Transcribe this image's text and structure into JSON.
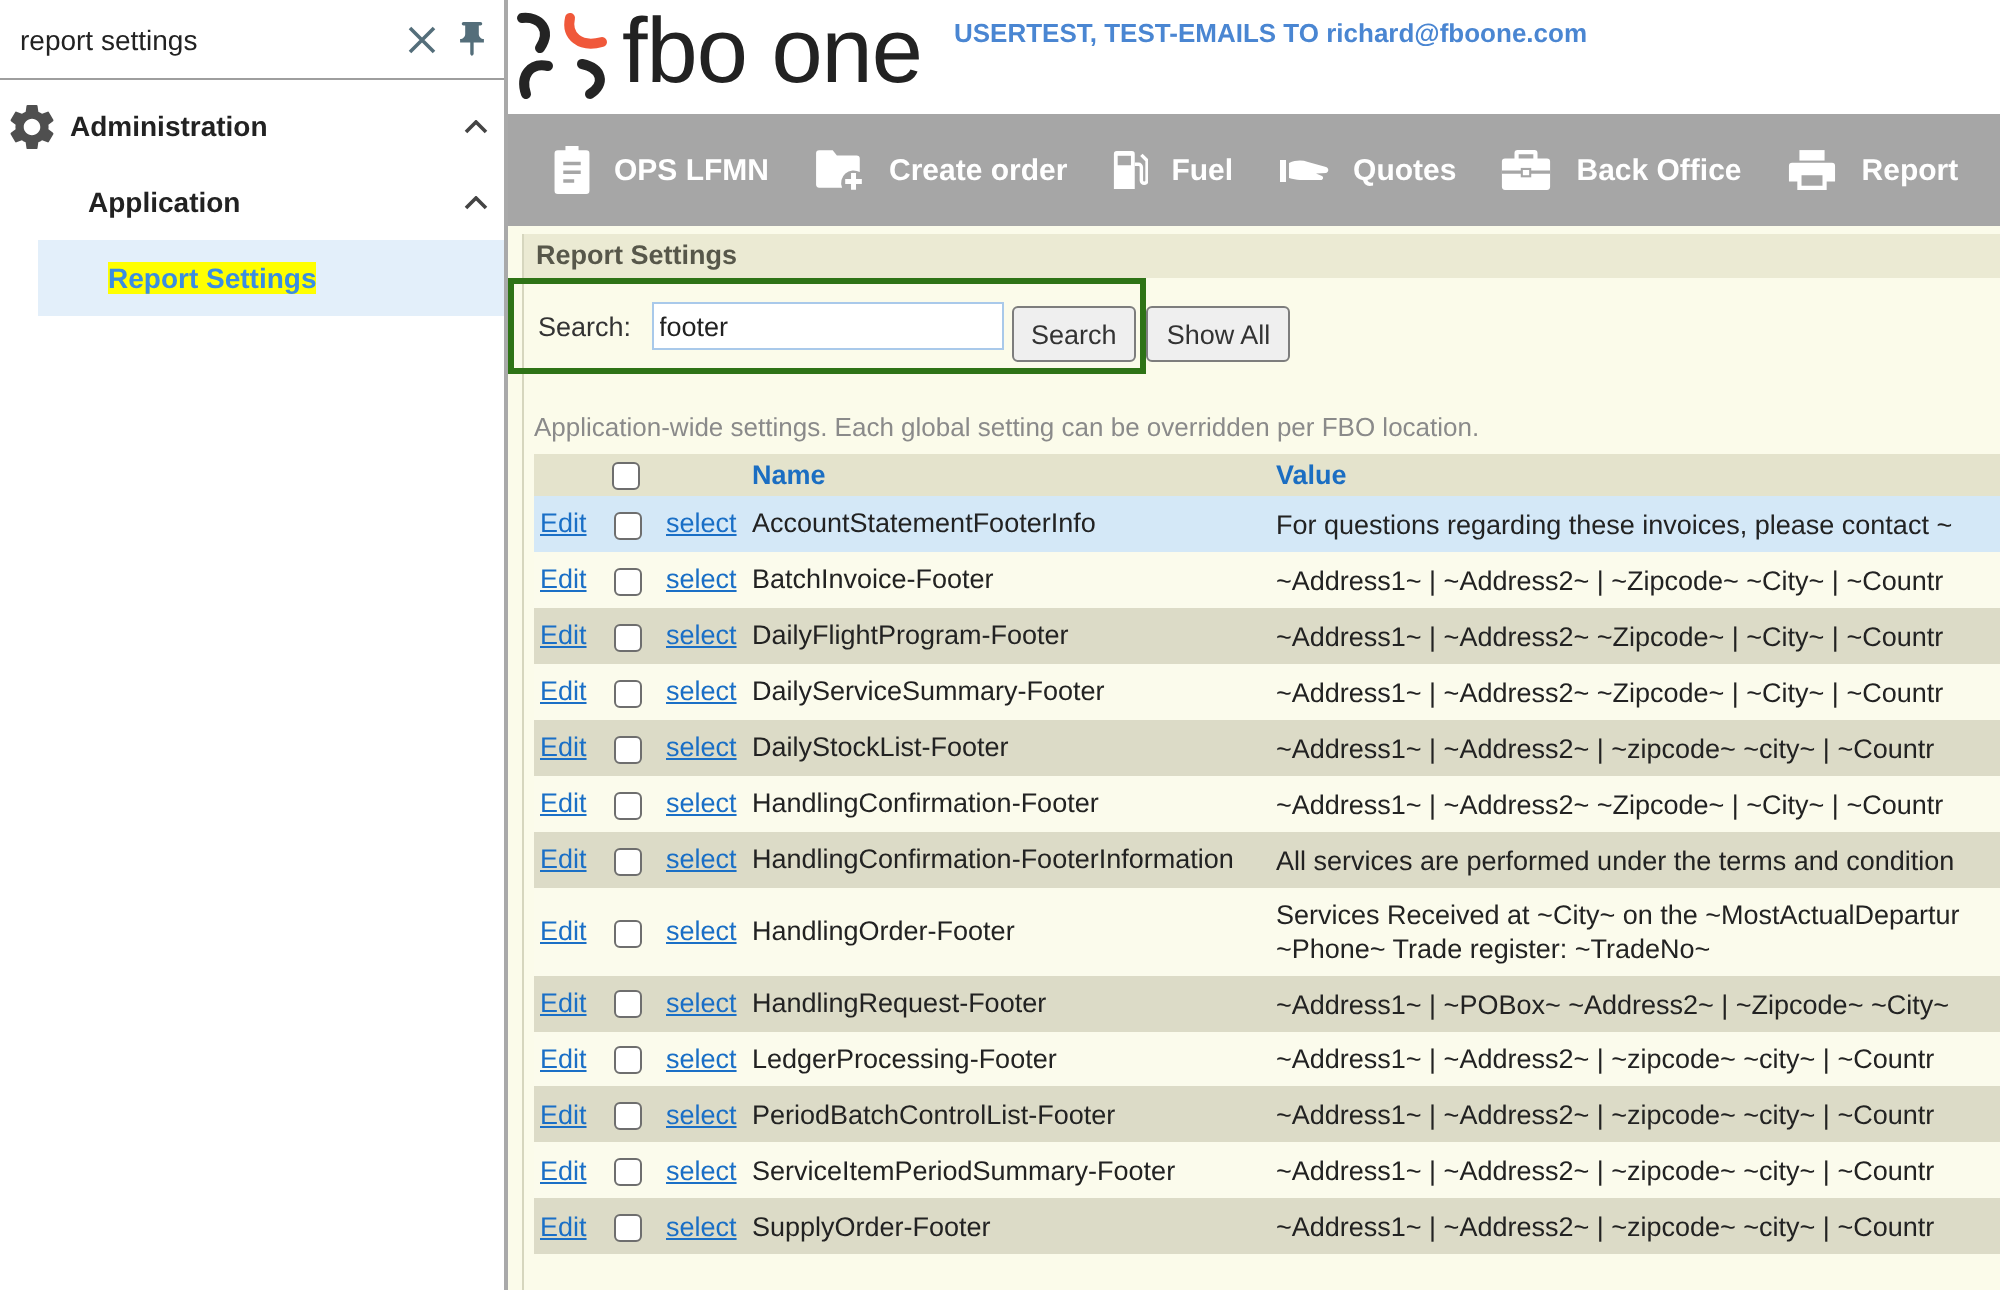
{
  "sidebar": {
    "search": {
      "value": "report settings"
    },
    "items": [
      {
        "label": "Administration",
        "expanded": true,
        "selected": false,
        "match": false,
        "children": [
          {
            "label": "Application",
            "expanded": true,
            "selected": false,
            "match": false,
            "children": [
              {
                "label": "Report Settings",
                "selected": true,
                "match": true
              }
            ]
          }
        ]
      }
    ]
  },
  "header": {
    "logo": "fbo one",
    "notice": "USERTEST, TEST-EMAILS TO richard@fboone.com"
  },
  "nav": [
    {
      "label": "OPS LFMN"
    },
    {
      "label": "Create order"
    },
    {
      "label": "Fuel"
    },
    {
      "label": "Quotes"
    },
    {
      "label": "Back Office"
    },
    {
      "label": "Report"
    }
  ],
  "panel": {
    "title": "Report Settings",
    "search": {
      "label": "Search:",
      "value": "footer",
      "button": "Search",
      "highlighted": true
    },
    "show_all": "Show All",
    "description": "Application-wide settings. Each global setting can be overridden per FBO location.",
    "table": {
      "select_all_checked": false,
      "columns": [
        "Name",
        "Value"
      ],
      "rows": [
        {
          "edit": "Edit",
          "checked": false,
          "select": "select",
          "name": "AccountStatementFooterInfo",
          "value": [
            "For questions regarding these invoices, please contact ~"
          ],
          "selected": true
        },
        {
          "edit": "Edit",
          "checked": false,
          "select": "select",
          "name": "BatchInvoice-Footer",
          "value": [
            "~Address1~ | ~Address2~ | ~Zipcode~ ~City~ | ~Countr"
          ],
          "selected": false
        },
        {
          "edit": "Edit",
          "checked": false,
          "select": "select",
          "name": "DailyFlightProgram-Footer",
          "value": [
            "~Address1~ | ~Address2~ ~Zipcode~ | ~City~ | ~Countr"
          ],
          "selected": false
        },
        {
          "edit": "Edit",
          "checked": false,
          "select": "select",
          "name": "DailyServiceSummary-Footer",
          "value": [
            "~Address1~ | ~Address2~ ~Zipcode~ | ~City~ | ~Countr"
          ],
          "selected": false
        },
        {
          "edit": "Edit",
          "checked": false,
          "select": "select",
          "name": "DailyStockList-Footer",
          "value": [
            "~Address1~ | ~Address2~ | ~zipcode~ ~city~ | ~Countr"
          ],
          "selected": false
        },
        {
          "edit": "Edit",
          "checked": false,
          "select": "select",
          "name": "HandlingConfirmation-Footer",
          "value": [
            "~Address1~ | ~Address2~ ~Zipcode~ | ~City~ | ~Countr"
          ],
          "selected": false
        },
        {
          "edit": "Edit",
          "checked": false,
          "select": "select",
          "name": "HandlingConfirmation-FooterInformation",
          "value": [
            "All services are performed under the terms and condition"
          ],
          "selected": false
        },
        {
          "edit": "Edit",
          "checked": false,
          "select": "select",
          "name": "HandlingOrder-Footer",
          "value": [
            "Services Received at ~City~ on the ~MostActualDepartur",
            "~Phone~ Trade register: ~TradeNo~"
          ],
          "selected": false
        },
        {
          "edit": "Edit",
          "checked": false,
          "select": "select",
          "name": "HandlingRequest-Footer",
          "value": [
            "~Address1~ | ~POBox~ ~Address2~ | ~Zipcode~ ~City~"
          ],
          "selected": false
        },
        {
          "edit": "Edit",
          "checked": false,
          "select": "select",
          "name": "LedgerProcessing-Footer",
          "value": [
            "~Address1~ | ~Address2~ | ~zipcode~ ~city~ | ~Countr"
          ],
          "selected": false
        },
        {
          "edit": "Edit",
          "checked": false,
          "select": "select",
          "name": "PeriodBatchControlList-Footer",
          "value": [
            "~Address1~ | ~Address2~ | ~zipcode~ ~city~ | ~Countr"
          ],
          "selected": false
        },
        {
          "edit": "Edit",
          "checked": false,
          "select": "select",
          "name": "ServiceItemPeriodSummary-Footer",
          "value": [
            "~Address1~ | ~Address2~ | ~zipcode~ ~city~ | ~Countr"
          ],
          "selected": false
        },
        {
          "edit": "Edit",
          "checked": false,
          "select": "select",
          "name": "SupplyOrder-Footer",
          "value": [
            "~Address1~ | ~Address2~ | ~zipcode~ ~city~ | ~Countr"
          ],
          "selected": false
        }
      ]
    }
  }
}
